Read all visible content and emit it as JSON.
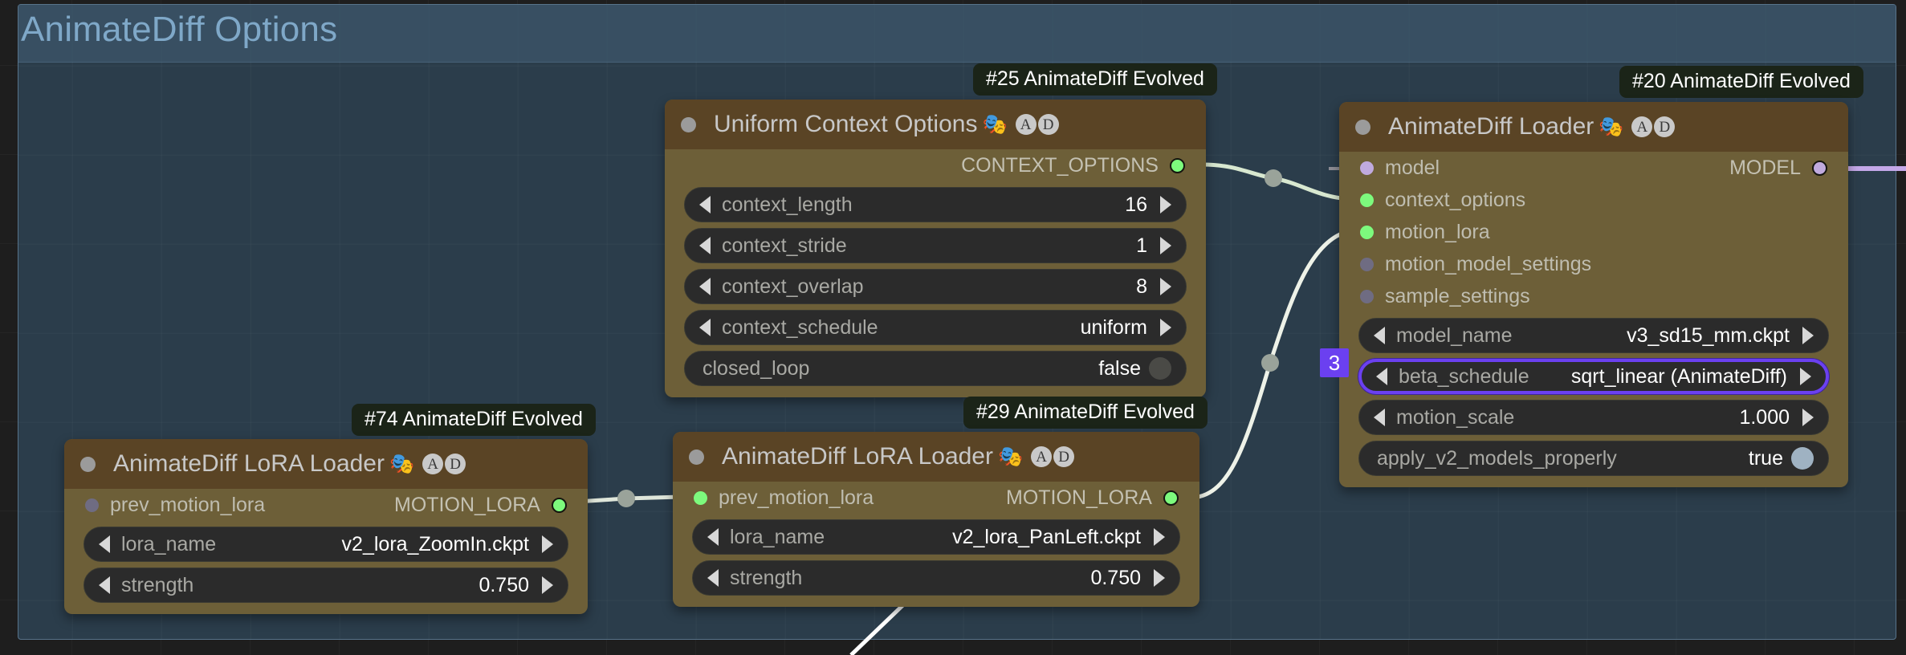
{
  "group": {
    "title": "AnimateDiff Options",
    "frame_color": "#3f596e",
    "border_color": "#7ca0be",
    "title_color": "#7fa8c8"
  },
  "colors": {
    "node_body": "#6d5f38",
    "node_header": "#5a4425",
    "widget_bg": "#2b2b2b",
    "highlight": "#6b40f0",
    "link_green": "#d8e8d0",
    "link_purple": "#c4a8e8",
    "dot_green": "#7dfa7d",
    "dot_purple": "#c0aade",
    "dot_grey": "#6f6c82",
    "badge_bg": "#1b2418"
  },
  "icons": {
    "masks": "🎭",
    "ad_a": "A",
    "ad_d": "D",
    "collapse": "collapse-dot"
  },
  "nodes": [
    {
      "id": "uniform-context-options",
      "badge": "#25 AnimateDiff Evolved",
      "title": "Uniform Context Options",
      "outputs": [
        {
          "label": "CONTEXT_OPTIONS",
          "dot": "green"
        }
      ],
      "inputs": [],
      "widgets": [
        {
          "name": "context_length",
          "value": "16",
          "type": "stepper"
        },
        {
          "name": "context_stride",
          "value": "1",
          "type": "stepper"
        },
        {
          "name": "context_overlap",
          "value": "8",
          "type": "stepper"
        },
        {
          "name": "context_schedule",
          "value": "uniform",
          "type": "stepper"
        },
        {
          "name": "closed_loop",
          "value": "false",
          "type": "toggle",
          "state": "off"
        }
      ]
    },
    {
      "id": "animatediff-loader",
      "badge": "#20 AnimateDiff Evolved",
      "title": "AnimateDiff Loader",
      "outputs": [
        {
          "label": "MODEL",
          "dot": "purple"
        }
      ],
      "inputs": [
        {
          "label": "model",
          "dot": "purple"
        },
        {
          "label": "context_options",
          "dot": "green"
        },
        {
          "label": "motion_lora",
          "dot": "green"
        },
        {
          "label": "motion_model_settings",
          "dot": "grey"
        },
        {
          "label": "sample_settings",
          "dot": "grey"
        }
      ],
      "widgets": [
        {
          "name": "model_name",
          "value": "v3_sd15_mm.ckpt",
          "type": "stepper"
        },
        {
          "name": "beta_schedule",
          "value": "sqrt_linear (AnimateDiff)",
          "type": "stepper",
          "highlight": true,
          "order_badge": "3"
        },
        {
          "name": "motion_scale",
          "value": "1.000",
          "type": "stepper"
        },
        {
          "name": "apply_v2_models_properly",
          "value": "true",
          "type": "toggle",
          "state": "on"
        }
      ]
    },
    {
      "id": "animatediff-lora-loader-74",
      "badge": "#74 AnimateDiff Evolved",
      "title": "AnimateDiff LoRA Loader",
      "outputs": [
        {
          "label": "MOTION_LORA",
          "dot": "green"
        }
      ],
      "inputs": [
        {
          "label": "prev_motion_lora",
          "dot": "grey"
        }
      ],
      "widgets": [
        {
          "name": "lora_name",
          "value": "v2_lora_ZoomIn.ckpt",
          "type": "stepper"
        },
        {
          "name": "strength",
          "value": "0.750",
          "type": "stepper"
        }
      ]
    },
    {
      "id": "animatediff-lora-loader-29",
      "badge": "#29 AnimateDiff Evolved",
      "title": "AnimateDiff LoRA Loader",
      "outputs": [
        {
          "label": "MOTION_LORA",
          "dot": "green"
        }
      ],
      "inputs": [
        {
          "label": "prev_motion_lora",
          "dot": "green"
        }
      ],
      "widgets": [
        {
          "name": "lora_name",
          "value": "v2_lora_PanLeft.ckpt",
          "type": "stepper"
        },
        {
          "name": "strength",
          "value": "0.750",
          "type": "stepper"
        }
      ]
    }
  ]
}
